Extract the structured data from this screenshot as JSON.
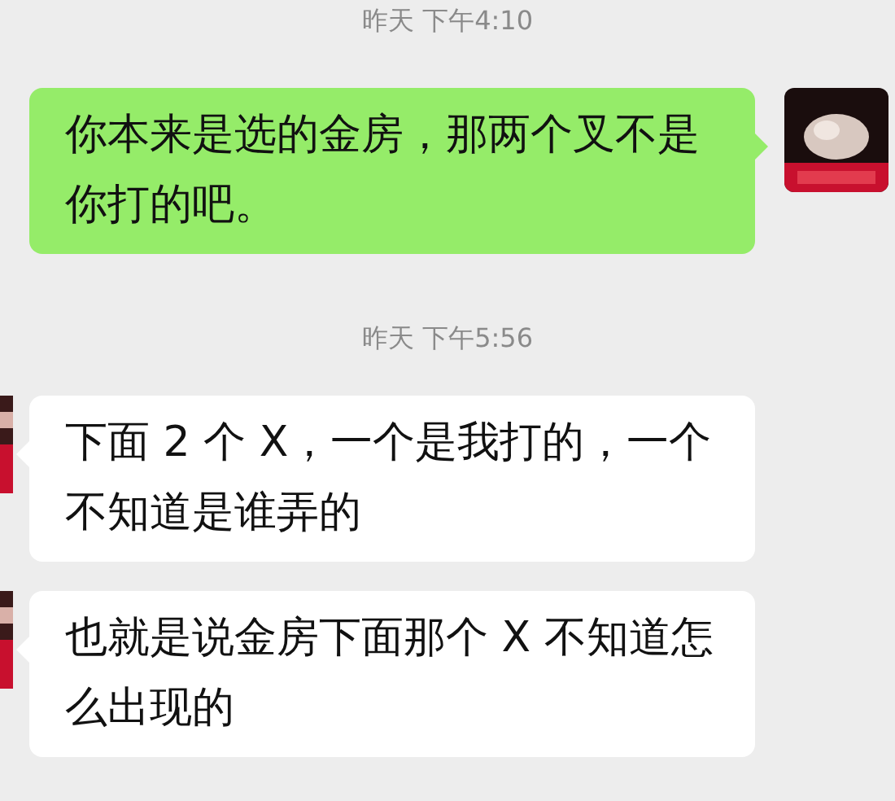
{
  "messages": [
    {
      "kind": "time",
      "text": "昨天 下午4:10"
    },
    {
      "kind": "sent",
      "text": "你本来是选的金房，那两个叉不是你打的吧。"
    },
    {
      "kind": "time",
      "text": "昨天 下午5:56"
    },
    {
      "kind": "received",
      "text": "下面 2 个 X，一个是我打的，一个不知道是谁弄的"
    },
    {
      "kind": "received",
      "text": "也就是说金房下面那个 X 不知道怎么出现的"
    }
  ]
}
